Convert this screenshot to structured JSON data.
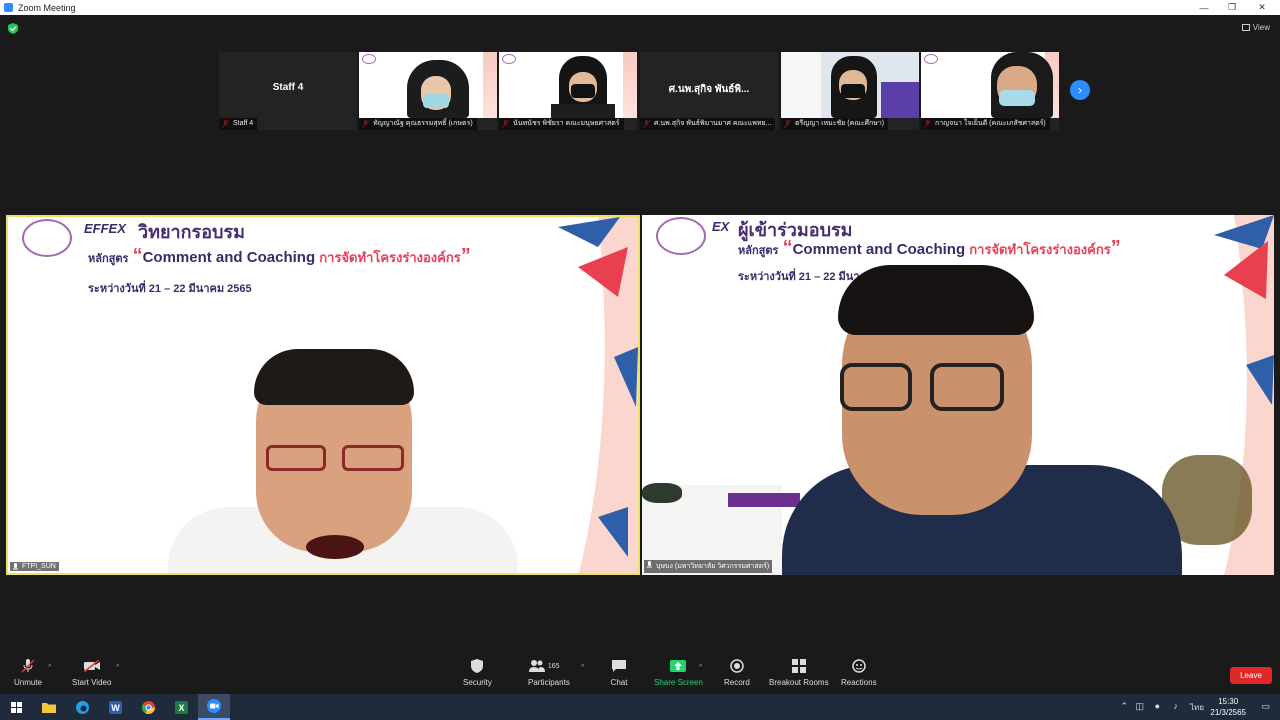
{
  "window": {
    "title": "Zoom Meeting",
    "controls": [
      "—",
      "❐",
      "✕"
    ]
  },
  "view_label": "View",
  "filmstrip": [
    {
      "name_label": "Staff 4",
      "center_label": "Staff 4",
      "type": "name"
    },
    {
      "name_label": "ทัญญาณัฐ คุณธรรมสุทธิ์ (เกษตร)",
      "type": "video"
    },
    {
      "name_label": "นันทนัชร พิชัยรา คณะมนุษยศาสตร์",
      "type": "video"
    },
    {
      "name_label": "ศ.นพ.สุกิจ พันธ์พิมานมาศ คณะแพทย...",
      "center_label": "ศ.นพ.สุกิจ พันธ์พิ...",
      "type": "name"
    },
    {
      "name_label": "ตรีญญา เหมะชัย (คณะศึกษา)",
      "type": "video"
    },
    {
      "name_label": "กาญจนา ใจเย็นดี (คณะเภสัชศาสตร์)",
      "type": "video"
    }
  ],
  "main_videos": [
    {
      "slide_title": "วิทยากรอบรม",
      "course_prefix": "หลักสูตร",
      "course_en": "Comment and Coaching",
      "course_th": "การจัดทำโครงร่างองค์กร",
      "dates": "ระหว่างวันที่ 21 – 22 มีนาคม 2565",
      "name_label": "FTPI_SUN",
      "active": true
    },
    {
      "slide_title": "ผู้เข้าร่วมอบรม",
      "course_prefix": "หลักสูตร",
      "course_en": "Comment and Coaching",
      "course_th": "การจัดทำโครงร่างองค์กร",
      "dates": "ระหว่างวันที่ 21 – 22 มีนา",
      "name_label": "บุษบง (มหาวิทยาลัย วิศวกรรมศาสตร์)",
      "active": false
    }
  ],
  "toolbar": {
    "unmute": "Unmute",
    "start_video": "Start Video",
    "security": "Security",
    "participants": "Participants",
    "participants_count": "165",
    "chat": "Chat",
    "share_screen": "Share Screen",
    "record": "Record",
    "breakout_rooms": "Breakout Rooms",
    "reactions": "Reactions",
    "leave": "Leave"
  },
  "taskbar": {
    "time": "15:30",
    "date": "21/3/2565",
    "lang": "ไทย"
  },
  "colors": {
    "zoom_blue": "#2d8cff",
    "leave_red": "#e02828",
    "share_green": "#24d56b",
    "active_border": "#e9e26a"
  }
}
